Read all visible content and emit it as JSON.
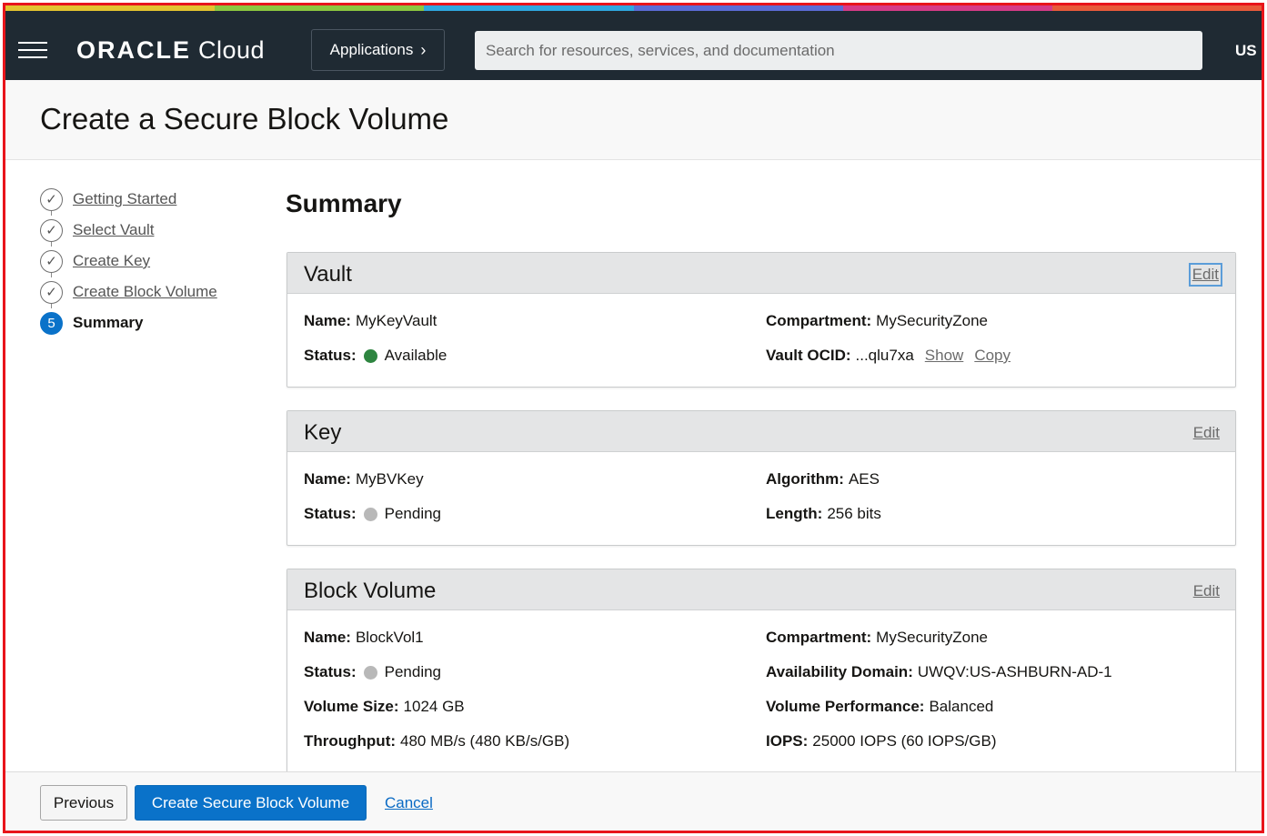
{
  "colors": {
    "accent": "#0a72c9",
    "topbar": "#1f2a33",
    "frame_border": "#e8141b",
    "status_available": "#2e8540",
    "status_pending": "#b8b8b8",
    "stripe": [
      "#e3c32f",
      "#8cc63f",
      "#2fa8e0",
      "#5b6cd6",
      "#d63b87",
      "#e85a3a"
    ]
  },
  "topbar": {
    "menu_icon": "hamburger-icon",
    "logo_bold": "ORACLE",
    "logo_light": "Cloud",
    "applications_label": "Applications",
    "applications_icon": "chevron-right-icon",
    "search_placeholder": "Search for resources, services, and documentation",
    "region": "US"
  },
  "page_title": "Create a Secure Block Volume",
  "steps": [
    {
      "label": "Getting Started",
      "state": "complete",
      "icon": "check-circle-icon"
    },
    {
      "label": "Select Vault",
      "state": "complete",
      "icon": "check-circle-icon"
    },
    {
      "label": "Create Key",
      "state": "complete",
      "icon": "check-circle-icon"
    },
    {
      "label": "Create Block Volume",
      "state": "complete",
      "icon": "check-circle-icon"
    },
    {
      "label": "Summary",
      "state": "current",
      "number": "5"
    }
  ],
  "summary_title": "Summary",
  "vault": {
    "title": "Vault",
    "edit_label": "Edit",
    "name_key": "Name:",
    "name_val": "MyKeyVault",
    "status_key": "Status:",
    "status_val": "Available",
    "compartment_key": "Compartment:",
    "compartment_val": "MySecurityZone",
    "ocid_key": "Vault OCID:",
    "ocid_val": "...qlu7xa",
    "show_label": "Show",
    "copy_label": "Copy"
  },
  "key": {
    "title": "Key",
    "edit_label": "Edit",
    "name_key": "Name:",
    "name_val": "MyBVKey",
    "status_key": "Status:",
    "status_val": "Pending",
    "algorithm_key": "Algorithm:",
    "algorithm_val": "AES",
    "length_key": "Length:",
    "length_val": "256 bits"
  },
  "block_volume": {
    "title": "Block Volume",
    "edit_label": "Edit",
    "name_key": "Name:",
    "name_val": "BlockVol1",
    "status_key": "Status:",
    "status_val": "Pending",
    "size_key": "Volume Size:",
    "size_val": "1024 GB",
    "throughput_key": "Throughput:",
    "throughput_val": "480 MB/s (480 KB/s/GB)",
    "compartment_key": "Compartment:",
    "compartment_val": "MySecurityZone",
    "ad_key": "Availability Domain:",
    "ad_val": "UWQV:US-ASHBURN-AD-1",
    "perf_key": "Volume Performance:",
    "perf_val": "Balanced",
    "iops_key": "IOPS:",
    "iops_val": "25000 IOPS (60 IOPS/GB)"
  },
  "footer": {
    "previous_label": "Previous",
    "create_label": "Create Secure Block Volume",
    "cancel_label": "Cancel"
  }
}
